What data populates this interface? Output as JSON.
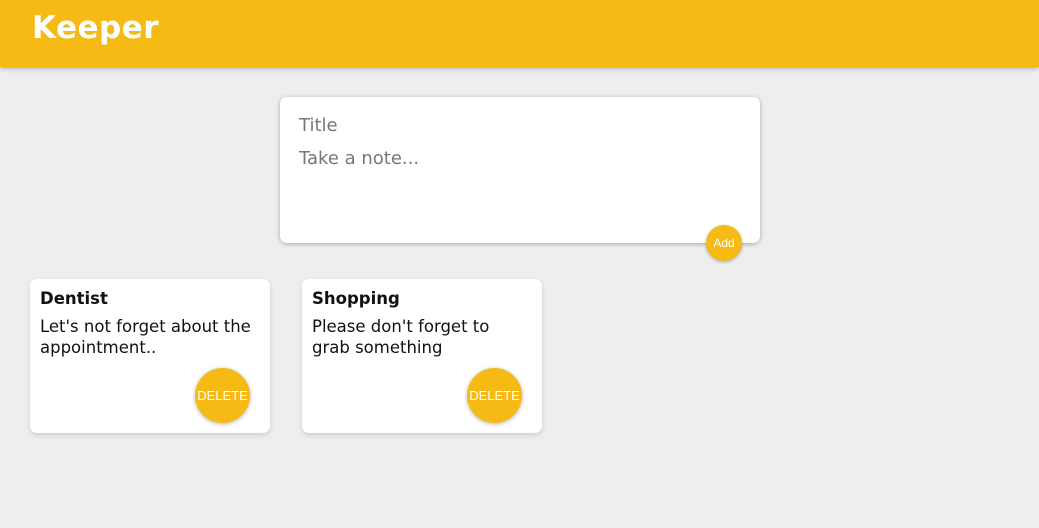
{
  "header": {
    "title": "Keeper",
    "background_color": "#f5ba13"
  },
  "create_area": {
    "title_placeholder": "Title",
    "content_placeholder": "Take a note...",
    "add_label": "Add"
  },
  "notes": [
    {
      "title": "Dentist",
      "content": "Let's not forget about the appointment..",
      "delete_label": "DELETE"
    },
    {
      "title": "Shopping",
      "content": "Please don't forget to grab something",
      "delete_label": "DELETE"
    }
  ],
  "colors": {
    "accent": "#f5ba13",
    "background": "#eeeeee",
    "card": "#ffffff"
  }
}
